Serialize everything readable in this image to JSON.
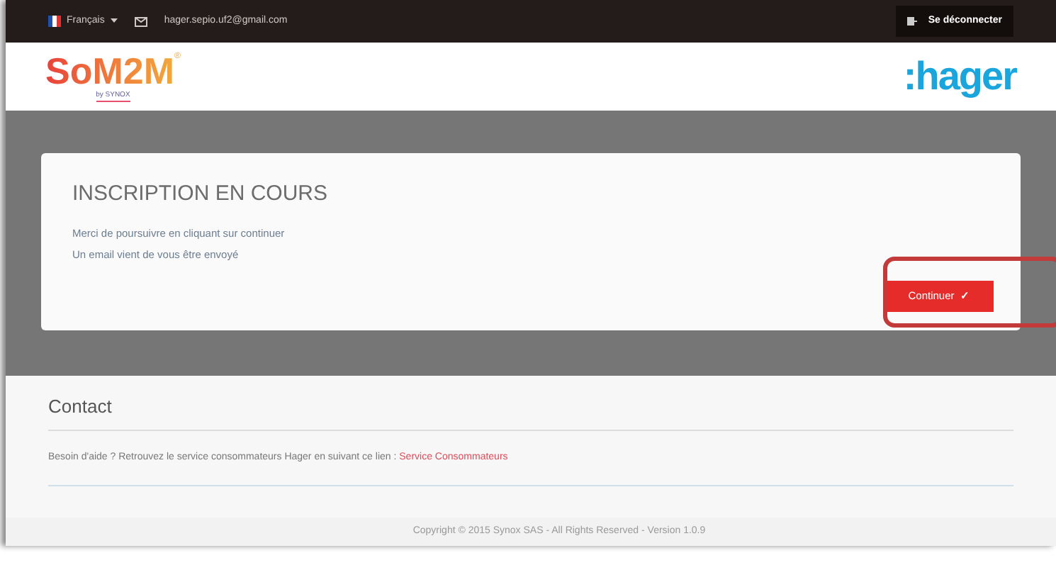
{
  "top_bar": {
    "language": "Français",
    "email": "hager.sepio.uf2@gmail.com",
    "logout": "Se déconnecter"
  },
  "header": {
    "logo": "SoM2M",
    "logo_mark": "®",
    "logo_tagline": "by SYNOX",
    "brand": ":hager"
  },
  "card": {
    "title": "INSCRIPTION EN COURS",
    "lines": [
      "Merci de poursuivre en cliquant sur continuer",
      "Un email vient de vous être envoyé"
    ],
    "button": "Continuer",
    "button_icon": "✓",
    "highlighted": true
  },
  "contact": {
    "title": "Contact",
    "text": "Besoin d'aide ? Retrouvez le service consommateurs Hager en suivant ce lien : ",
    "link": "Service Consommateurs"
  },
  "footer": {
    "copyright": "Copyright © 2015 Synox SAS - All Rights Reserved - Version 1.0.9"
  }
}
